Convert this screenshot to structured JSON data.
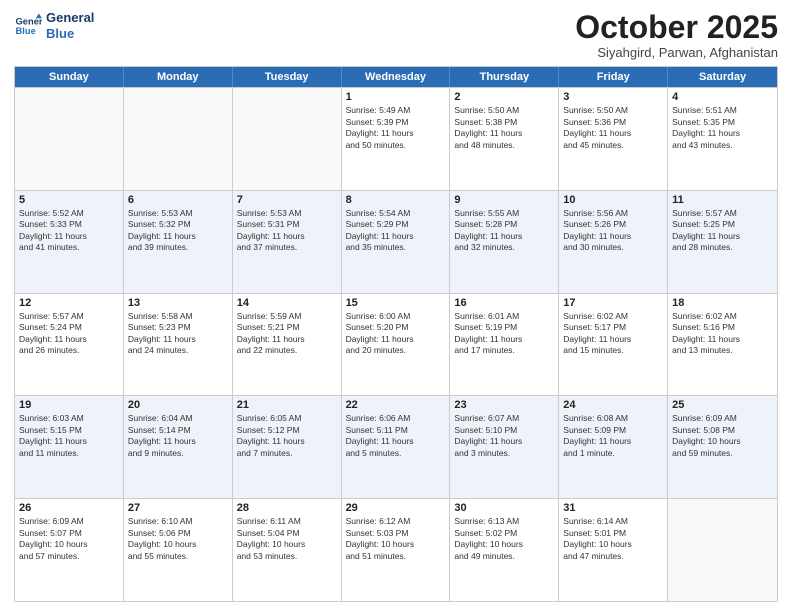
{
  "logo": {
    "line1": "General",
    "line2": "Blue"
  },
  "title": "October 2025",
  "subtitle": "Siyahgird, Parwan, Afghanistan",
  "weekdays": [
    "Sunday",
    "Monday",
    "Tuesday",
    "Wednesday",
    "Thursday",
    "Friday",
    "Saturday"
  ],
  "rows": [
    [
      {
        "day": "",
        "info": ""
      },
      {
        "day": "",
        "info": ""
      },
      {
        "day": "",
        "info": ""
      },
      {
        "day": "1",
        "info": "Sunrise: 5:49 AM\nSunset: 5:39 PM\nDaylight: 11 hours\nand 50 minutes."
      },
      {
        "day": "2",
        "info": "Sunrise: 5:50 AM\nSunset: 5:38 PM\nDaylight: 11 hours\nand 48 minutes."
      },
      {
        "day": "3",
        "info": "Sunrise: 5:50 AM\nSunset: 5:36 PM\nDaylight: 11 hours\nand 45 minutes."
      },
      {
        "day": "4",
        "info": "Sunrise: 5:51 AM\nSunset: 5:35 PM\nDaylight: 11 hours\nand 43 minutes."
      }
    ],
    [
      {
        "day": "5",
        "info": "Sunrise: 5:52 AM\nSunset: 5:33 PM\nDaylight: 11 hours\nand 41 minutes."
      },
      {
        "day": "6",
        "info": "Sunrise: 5:53 AM\nSunset: 5:32 PM\nDaylight: 11 hours\nand 39 minutes."
      },
      {
        "day": "7",
        "info": "Sunrise: 5:53 AM\nSunset: 5:31 PM\nDaylight: 11 hours\nand 37 minutes."
      },
      {
        "day": "8",
        "info": "Sunrise: 5:54 AM\nSunset: 5:29 PM\nDaylight: 11 hours\nand 35 minutes."
      },
      {
        "day": "9",
        "info": "Sunrise: 5:55 AM\nSunset: 5:28 PM\nDaylight: 11 hours\nand 32 minutes."
      },
      {
        "day": "10",
        "info": "Sunrise: 5:56 AM\nSunset: 5:26 PM\nDaylight: 11 hours\nand 30 minutes."
      },
      {
        "day": "11",
        "info": "Sunrise: 5:57 AM\nSunset: 5:25 PM\nDaylight: 11 hours\nand 28 minutes."
      }
    ],
    [
      {
        "day": "12",
        "info": "Sunrise: 5:57 AM\nSunset: 5:24 PM\nDaylight: 11 hours\nand 26 minutes."
      },
      {
        "day": "13",
        "info": "Sunrise: 5:58 AM\nSunset: 5:23 PM\nDaylight: 11 hours\nand 24 minutes."
      },
      {
        "day": "14",
        "info": "Sunrise: 5:59 AM\nSunset: 5:21 PM\nDaylight: 11 hours\nand 22 minutes."
      },
      {
        "day": "15",
        "info": "Sunrise: 6:00 AM\nSunset: 5:20 PM\nDaylight: 11 hours\nand 20 minutes."
      },
      {
        "day": "16",
        "info": "Sunrise: 6:01 AM\nSunset: 5:19 PM\nDaylight: 11 hours\nand 17 minutes."
      },
      {
        "day": "17",
        "info": "Sunrise: 6:02 AM\nSunset: 5:17 PM\nDaylight: 11 hours\nand 15 minutes."
      },
      {
        "day": "18",
        "info": "Sunrise: 6:02 AM\nSunset: 5:16 PM\nDaylight: 11 hours\nand 13 minutes."
      }
    ],
    [
      {
        "day": "19",
        "info": "Sunrise: 6:03 AM\nSunset: 5:15 PM\nDaylight: 11 hours\nand 11 minutes."
      },
      {
        "day": "20",
        "info": "Sunrise: 6:04 AM\nSunset: 5:14 PM\nDaylight: 11 hours\nand 9 minutes."
      },
      {
        "day": "21",
        "info": "Sunrise: 6:05 AM\nSunset: 5:12 PM\nDaylight: 11 hours\nand 7 minutes."
      },
      {
        "day": "22",
        "info": "Sunrise: 6:06 AM\nSunset: 5:11 PM\nDaylight: 11 hours\nand 5 minutes."
      },
      {
        "day": "23",
        "info": "Sunrise: 6:07 AM\nSunset: 5:10 PM\nDaylight: 11 hours\nand 3 minutes."
      },
      {
        "day": "24",
        "info": "Sunrise: 6:08 AM\nSunset: 5:09 PM\nDaylight: 11 hours\nand 1 minute."
      },
      {
        "day": "25",
        "info": "Sunrise: 6:09 AM\nSunset: 5:08 PM\nDaylight: 10 hours\nand 59 minutes."
      }
    ],
    [
      {
        "day": "26",
        "info": "Sunrise: 6:09 AM\nSunset: 5:07 PM\nDaylight: 10 hours\nand 57 minutes."
      },
      {
        "day": "27",
        "info": "Sunrise: 6:10 AM\nSunset: 5:06 PM\nDaylight: 10 hours\nand 55 minutes."
      },
      {
        "day": "28",
        "info": "Sunrise: 6:11 AM\nSunset: 5:04 PM\nDaylight: 10 hours\nand 53 minutes."
      },
      {
        "day": "29",
        "info": "Sunrise: 6:12 AM\nSunset: 5:03 PM\nDaylight: 10 hours\nand 51 minutes."
      },
      {
        "day": "30",
        "info": "Sunrise: 6:13 AM\nSunset: 5:02 PM\nDaylight: 10 hours\nand 49 minutes."
      },
      {
        "day": "31",
        "info": "Sunrise: 6:14 AM\nSunset: 5:01 PM\nDaylight: 10 hours\nand 47 minutes."
      },
      {
        "day": "",
        "info": ""
      }
    ]
  ]
}
